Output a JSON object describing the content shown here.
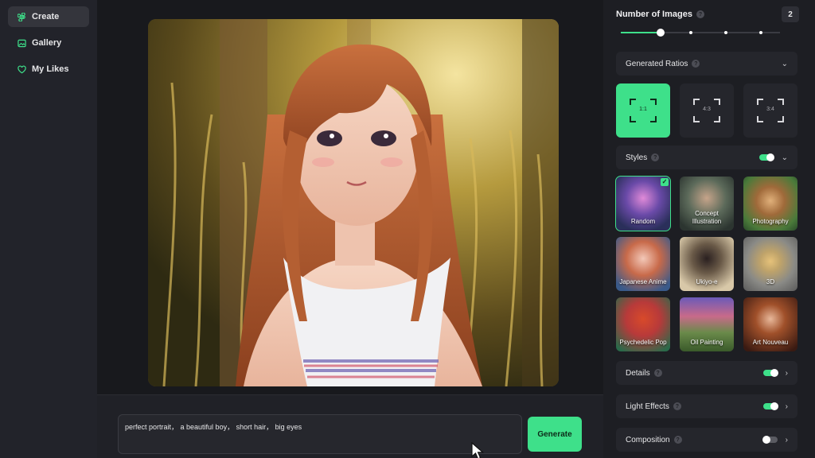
{
  "sidebar": {
    "items": [
      {
        "label": "Create",
        "icon": "command-icon",
        "active": true
      },
      {
        "label": "Gallery",
        "icon": "gallery-icon",
        "active": false
      },
      {
        "label": "My Likes",
        "icon": "heart-icon",
        "active": false
      }
    ]
  },
  "prompt": {
    "value": "perfect portrait， a beautiful boy， short hair， big eyes",
    "generate_label": "Generate"
  },
  "panel": {
    "number_of_images": {
      "label": "Number of Images",
      "value": "2",
      "slider_fraction": 0.25
    },
    "ratios": {
      "label": "Generated Ratios",
      "options": [
        {
          "label": "1:1",
          "selected": true
        },
        {
          "label": "4:3",
          "selected": false
        },
        {
          "label": "3:4",
          "selected": false
        }
      ]
    },
    "styles": {
      "label": "Styles",
      "enabled": true,
      "items": [
        {
          "label": "Random",
          "selected": true
        },
        {
          "label": "Concept Illustration",
          "selected": false
        },
        {
          "label": "Photography",
          "selected": false
        },
        {
          "label": "Japanese Anime",
          "selected": false
        },
        {
          "label": "Ukiyo-e",
          "selected": false
        },
        {
          "label": "3D",
          "selected": false
        },
        {
          "label": "Psychedelic Pop",
          "selected": false
        },
        {
          "label": "Oil Painting",
          "selected": false
        },
        {
          "label": "Art Nouveau",
          "selected": false
        }
      ]
    },
    "details": {
      "label": "Details",
      "enabled": true
    },
    "light_effects": {
      "label": "Light Effects",
      "enabled": true
    },
    "composition": {
      "label": "Composition",
      "enabled": false
    }
  },
  "colors": {
    "accent": "#3ee08a",
    "background": "#18191d",
    "panel": "#1d1e23"
  }
}
